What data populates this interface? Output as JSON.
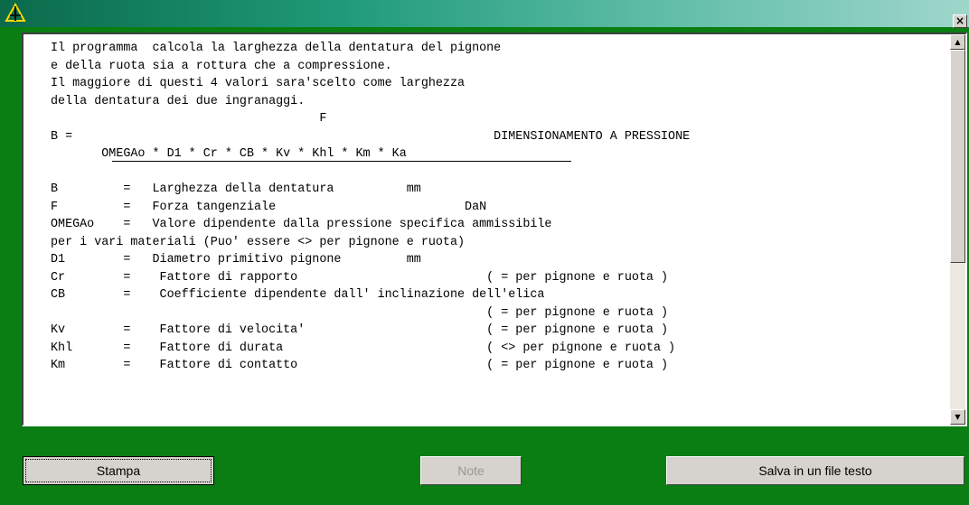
{
  "window": {
    "close_glyph": "×"
  },
  "content": {
    "lines": [
      "Il programma  calcola la larghezza della dentatura del pignone",
      "e della ruota sia a rottura che a compressione.",
      "Il maggiore di questi 4 valori sara'scelto come larghezza",
      "della dentatura dei due ingranaggi.",
      "                                     F",
      "B =                                                          DIMENSIONAMENTO A PRESSIONE",
      "       OMEGAo * D1 * Cr * CB * Kv * Khl * Km * Ka",
      "",
      "B         =   Larghezza della dentatura          mm",
      "F         =   Forza tangenziale                          DaN",
      "OMEGAo    =   Valore dipendente dalla pressione specifica ammissibile",
      "per i vari materiali (Puo' essere <> per pignone e ruota)",
      "D1        =   Diametro primitivo pignone         mm",
      "Cr        =    Fattore di rapporto                          ( = per pignone e ruota )",
      "CB        =    Coefficiente dipendente dall' inclinazione dell'elica",
      "                                                            ( = per pignone e ruota )",
      "Kv        =    Fattore di velocita'                         ( = per pignone e ruota )",
      "Khl       =    Fattore di durata                            ( <> per pignone e ruota )",
      "Km        =    Fattore di contatto                          ( = per pignone e ruota )"
    ]
  },
  "buttons": {
    "print_label": "Stampa",
    "notes_label": "Note",
    "save_label": "Salva in un file testo"
  },
  "scroll": {
    "up_glyph": "▲",
    "down_glyph": "▼",
    "position": 0.0
  }
}
